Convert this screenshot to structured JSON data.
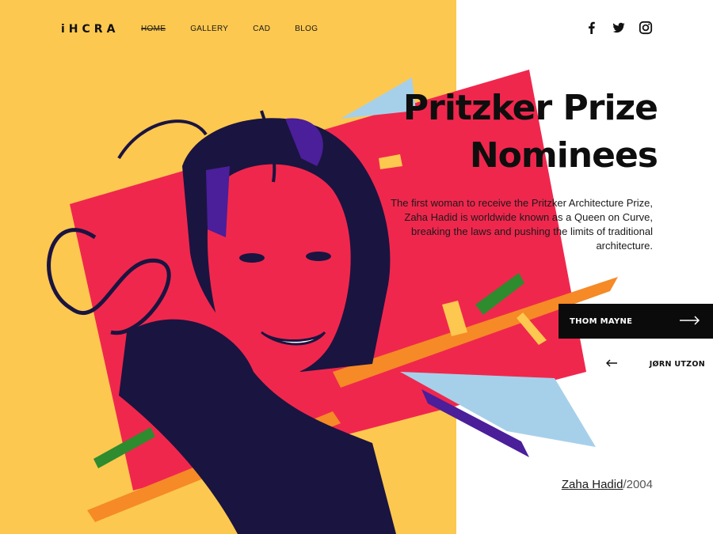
{
  "brand": {
    "logo": "iHCRA"
  },
  "nav": [
    {
      "label": "HOME",
      "active": true
    },
    {
      "label": "GALLERY",
      "active": false
    },
    {
      "label": "CAD",
      "active": false
    },
    {
      "label": "BLOG",
      "active": false
    }
  ],
  "social": [
    "facebook-icon",
    "twitter-icon",
    "instagram-icon"
  ],
  "hero": {
    "title_line1": "Pritzker Prize",
    "title_line2": "Nominees",
    "description": "The first woman to receive the Pritzker Architecture Prize, Zaha Hadid is worldwide known as a Queen on Curve, breaking the laws and pushing the limits of traditional architecture."
  },
  "nominees": {
    "next_label": "THOM MAYNE",
    "prev_label": "JØRN UTZON"
  },
  "caption": {
    "name": "Zaha Hadid",
    "year": "/2004"
  },
  "colors": {
    "yellow": "#fdc84f",
    "red": "#f0274d",
    "navy": "#1a1440",
    "blue": "#a6d0ea",
    "orange": "#f58a26",
    "purple": "#4b1e9a",
    "green": "#2e8b2e"
  }
}
